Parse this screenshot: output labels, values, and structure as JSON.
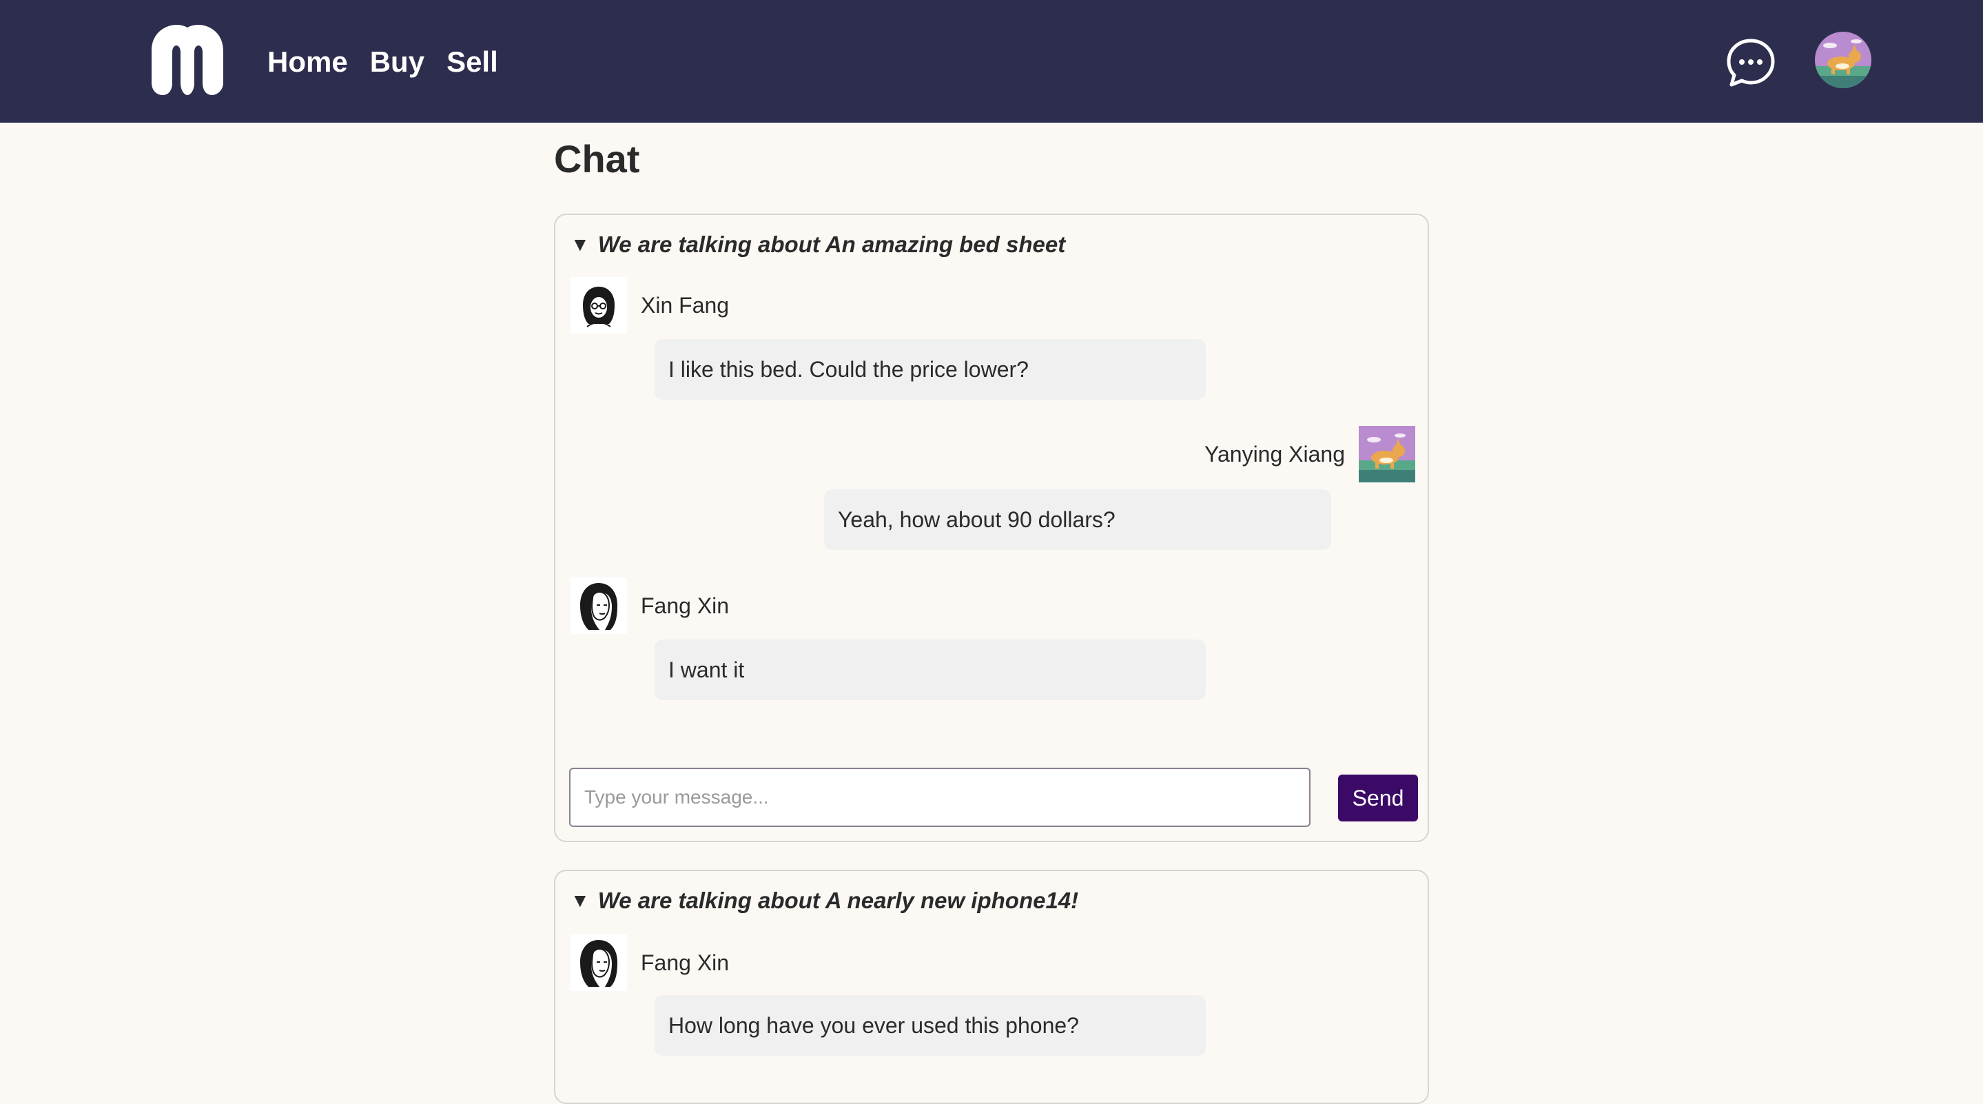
{
  "header": {
    "logo_icon": "m-logo-icon",
    "nav": [
      {
        "label": "Home"
      },
      {
        "label": "Buy"
      },
      {
        "label": "Sell"
      }
    ],
    "chat_icon": "chat-bubble-icon",
    "user_avatar": "corgi-avatar"
  },
  "page": {
    "title": "Chat"
  },
  "threads": [
    {
      "toggle_icon": "▼",
      "topic": "We are talking about An amazing bed sheet",
      "messages": [
        {
          "sender": "Xin Fang",
          "side": "left",
          "text": "I like this bed. Could the price lower?"
        },
        {
          "sender": "Yanying Xiang",
          "side": "right",
          "text": "Yeah, how about 90 dollars?"
        },
        {
          "sender": "Fang Xin",
          "side": "left",
          "text": "I want it"
        }
      ],
      "input_placeholder": "Type your message...",
      "send_label": "Send"
    },
    {
      "toggle_icon": "▼",
      "topic": "We are talking about A nearly new iphone14!",
      "messages": [
        {
          "sender": "Fang Xin",
          "side": "left",
          "text": "How long have you ever used this phone?"
        }
      ]
    }
  ],
  "colors": {
    "header_bg": "#2d2d4e",
    "page_bg": "#fcf9f5",
    "bubble_bg": "#f0f0f0",
    "send_button": "#3a0a66"
  }
}
